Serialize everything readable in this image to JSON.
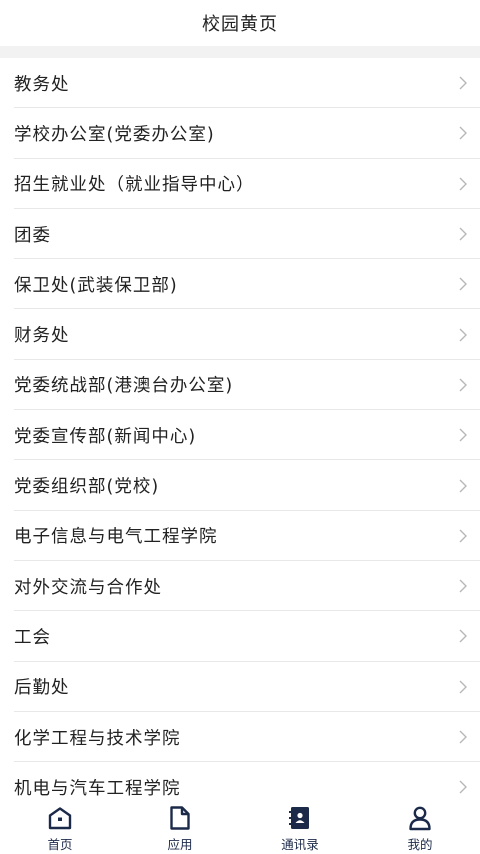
{
  "header": {
    "title": "校园黄页"
  },
  "departments": [
    {
      "label": "教务处"
    },
    {
      "label": "学校办公室(党委办公室)"
    },
    {
      "label": "招生就业处（就业指导中心）"
    },
    {
      "label": "团委"
    },
    {
      "label": "保卫处(武装保卫部)"
    },
    {
      "label": "财务处"
    },
    {
      "label": "党委统战部(港澳台办公室)"
    },
    {
      "label": "党委宣传部(新闻中心)"
    },
    {
      "label": "党委组织部(党校)"
    },
    {
      "label": "电子信息与电气工程学院"
    },
    {
      "label": "对外交流与合作处"
    },
    {
      "label": "工会"
    },
    {
      "label": "后勤处"
    },
    {
      "label": "化学工程与技术学院"
    },
    {
      "label": "机电与汽车工程学院"
    }
  ],
  "tabbar": {
    "home": {
      "label": "首页",
      "icon": "home-icon"
    },
    "apps": {
      "label": "应用",
      "icon": "document-icon"
    },
    "contacts": {
      "label": "通讯录",
      "icon": "contacts-book-icon",
      "active": true
    },
    "me": {
      "label": "我的",
      "icon": "user-icon"
    }
  },
  "colors": {
    "icon_navy": "#1c2a4a",
    "divider": "#e8e8e8",
    "chevron": "#b8b8b8",
    "gap": "#f2f2f2"
  }
}
